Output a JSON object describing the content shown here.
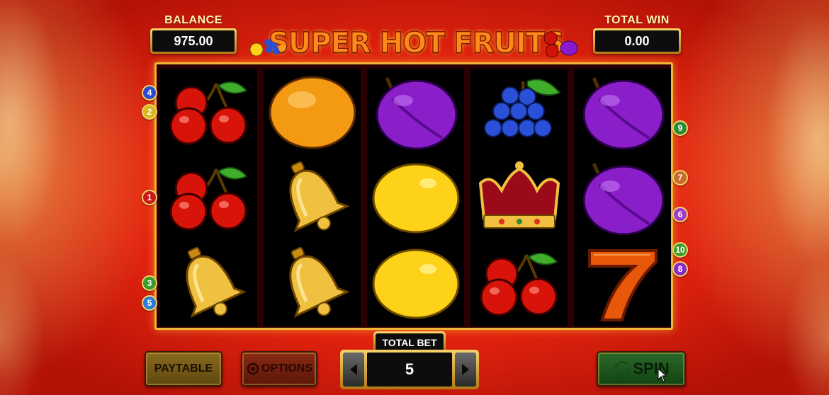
{
  "header": {
    "balance_label": "BALANCE",
    "balance_value": "975.00",
    "total_win_label": "TOTAL WIN",
    "total_win_value": "0.00",
    "logo_text": "SUPER HOT FRUITS"
  },
  "reels": [
    [
      "cherries",
      "cherries",
      "bell"
    ],
    [
      "orange",
      "bell",
      "bell"
    ],
    [
      "plum",
      "lemon",
      "lemon"
    ],
    [
      "grapes",
      "crown",
      "cherries"
    ],
    [
      "plum",
      "plum",
      "seven"
    ]
  ],
  "paylines_left": [
    "4",
    "2",
    "1",
    "3",
    "5"
  ],
  "paylines_right": [
    "9",
    "7",
    "6",
    "10",
    "8"
  ],
  "controls": {
    "paytable_label": "PAYTABLE",
    "options_label": "OPTIONS",
    "total_bet_label": "TOTAL BET",
    "total_bet_value": "5",
    "spin_label": "SPIN"
  },
  "colors": {
    "background": "#e0220e",
    "gold": "#f1b637",
    "spin_green": "#2b6a2b"
  }
}
